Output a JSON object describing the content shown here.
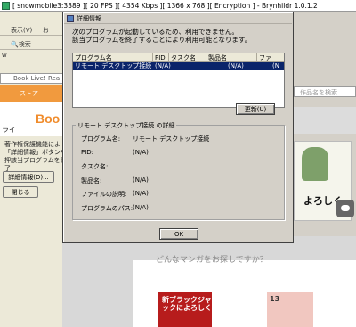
{
  "rdp_title": "[ snowmobile3:3389 ][ 20 FPS ][ 4354 Kbps ][ 1366 x 768 ][ Encryption ] - Brynhildr 1.0.1.2",
  "background": {
    "menu_view": "表示(V)",
    "menu_fav": "お",
    "search_btn": "検索",
    "address_prefix": "w",
    "tab_label": "Book Live! Rea",
    "store_label": "ストア",
    "boo_text": "Boo",
    "left_text_prefix": "ライ",
    "left_paragraph": "著作権保護機能によ「詳細情報」ボタンを押該当プログラムを終了",
    "detail_btn": "詳細情報(D)...",
    "close_btn": "閉じる",
    "search_placeholder": "作品名を検索",
    "bottom_question": "どんなマンガをお探しですか？",
    "cover1_text": "新ブラックジャックによろしく",
    "cover2_text": "13",
    "manga_right_title": "よろしく"
  },
  "dialog": {
    "title": "詳細情報",
    "message_line1": "次のプログラムが起動しているため、利用できません。",
    "message_line2": "該当プログラムを終了することにより利用可能となります。",
    "columns": [
      "プログラム名",
      "PID",
      "タスク名",
      "製品名",
      "ファ"
    ],
    "rows": [
      {
        "program": "リモート デスクトップ接続",
        "pid": "(N/A)",
        "task": "",
        "product": "(N/A)",
        "file": "(N"
      }
    ],
    "refresh_btn": "更新(U)",
    "details_group_title": "リモート デスクトップ接続 の詳細",
    "details": [
      {
        "label": "プログラム名:",
        "value": "リモート デスクトップ接続"
      },
      {
        "label": "PID:",
        "value": "(N/A)"
      },
      {
        "label": "タスク名:",
        "value": ""
      },
      {
        "label": "製品名:",
        "value": "(N/A)"
      },
      {
        "label": "ファイルの説明:",
        "value": "(N/A)"
      },
      {
        "label": "プログラムのパス:",
        "value": "(N/A)"
      }
    ],
    "ok_btn": "OK"
  }
}
